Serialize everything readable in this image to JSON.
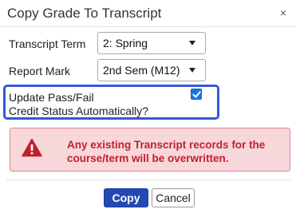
{
  "dialog": {
    "title": "Copy Grade To Transcript",
    "close_label": "×"
  },
  "form": {
    "transcript_term": {
      "label": "Transcript Term",
      "value": "2: Spring"
    },
    "report_mark": {
      "label": "Report Mark",
      "value": "2nd Sem (M12)"
    },
    "pass_fail": {
      "label_line1": "Update Pass/Fail",
      "label_line2": "Credit Status Automatically?",
      "checked": true
    }
  },
  "alert": {
    "icon": "warning-triangle-icon",
    "line1": "Any existing Transcript records for the",
    "line2": "course/term will be overwritten."
  },
  "buttons": {
    "copy_label": "Copy",
    "cancel_label": "Cancel"
  },
  "colors": {
    "highlight": "#3558d6",
    "alert_bg": "#f7d7da",
    "alert_text": "#c21f2e",
    "primary_button": "#2549b4",
    "checkbox": "#1a73e8"
  }
}
